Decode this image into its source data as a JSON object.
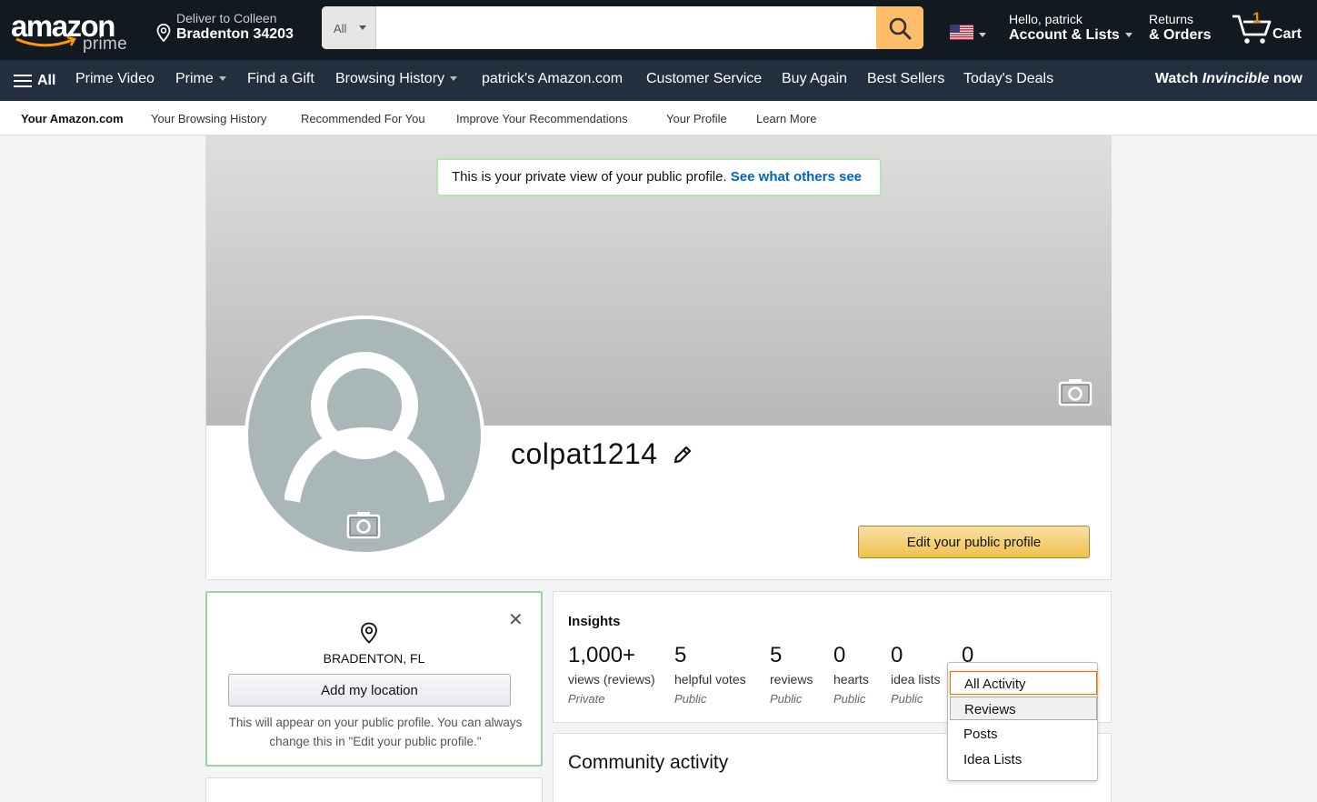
{
  "header": {
    "logo_text": "amazon",
    "logo_sub": "prime",
    "deliver_line1": "Deliver to Colleen",
    "deliver_line2": "Bradenton 34203",
    "search_category": "All",
    "search_placeholder": "",
    "greeting": "Hello, patrick",
    "account_label": "Account & Lists",
    "returns_line1": "Returns",
    "returns_line2": "& Orders",
    "cart_count": "1",
    "cart_label": "Cart",
    "accent": "#febd69",
    "background": "#131921"
  },
  "main_nav": {
    "all": "All",
    "items": [
      "Prime Video",
      "Prime",
      "Find a Gift",
      "Browsing History",
      "patrick's Amazon.com",
      "Customer Service",
      "Buy Again",
      "Best Sellers",
      "Today's Deals"
    ],
    "promo_prefix": "Watch",
    "promo_em": "Invincible",
    "promo_suffix": "now"
  },
  "sub_nav": {
    "items": [
      "Your Amazon.com",
      "Your Browsing History",
      "Recommended For You",
      "Improve Your Recommendations",
      "Your Profile",
      "Learn More"
    ]
  },
  "profile": {
    "notice_text": "This is your private view of your public profile.",
    "notice_link": "See what others see",
    "username": "colpat1214",
    "edit_button": "Edit your public profile"
  },
  "location": {
    "city": "BRADENTON, FL",
    "add_button": "Add my location",
    "hint": "This will appear on your public profile. You can always change this in \"Edit your public profile.\""
  },
  "insights": {
    "title": "Insights",
    "stats": [
      {
        "value": "1,000+",
        "label": "views (reviews)",
        "visibility": "Private"
      },
      {
        "value": "5",
        "label": "helpful votes",
        "visibility": "Public"
      },
      {
        "value": "5",
        "label": "reviews",
        "visibility": "Public"
      },
      {
        "value": "0",
        "label": "hearts",
        "visibility": "Public"
      },
      {
        "value": "0",
        "label": "idea lists",
        "visibility": "Public"
      },
      {
        "value": "0",
        "label": "",
        "visibility": ""
      }
    ]
  },
  "community": {
    "title": "Community activity"
  },
  "activity_filter": {
    "options": [
      "All Activity",
      "Reviews",
      "Posts",
      "Idea Lists"
    ],
    "selected": "All Activity"
  }
}
